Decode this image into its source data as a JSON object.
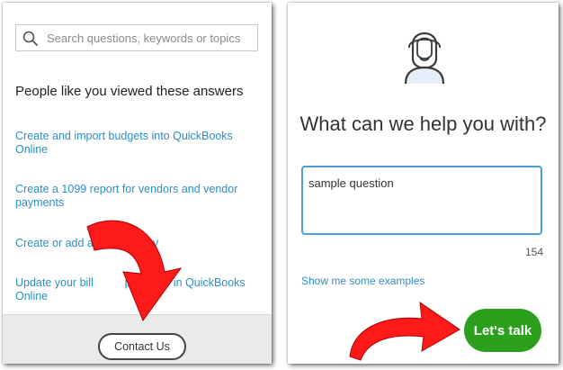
{
  "left_panel": {
    "search": {
      "placeholder": "Search questions, keywords or topics"
    },
    "heading": "People like you viewed these answers",
    "answers": [
      {
        "label": "Create and import budgets into QuickBooks Online"
      },
      {
        "label": "Create a 1099 report for vendors and vendor payments"
      },
      {
        "label": "Create or add and      mpany"
      },
      {
        "label": "Update your bill          ption info in QuickBooks Online"
      }
    ],
    "contact_button": "Contact Us"
  },
  "right_panel": {
    "title": "What can we help you with?",
    "question_value": "sample question",
    "char_count": "154",
    "examples_link": "Show me some examples",
    "talk_button": "Let's talk"
  },
  "colors": {
    "link": "#2b8fc6",
    "brand_green": "#2ca01c",
    "focus_border": "#4a9fd8",
    "annotation_arrow": "#ff1a1a"
  },
  "icons": [
    "search-icon",
    "support-agent-icon",
    "red-arrow-down-annotation",
    "red-arrow-right-annotation"
  ]
}
